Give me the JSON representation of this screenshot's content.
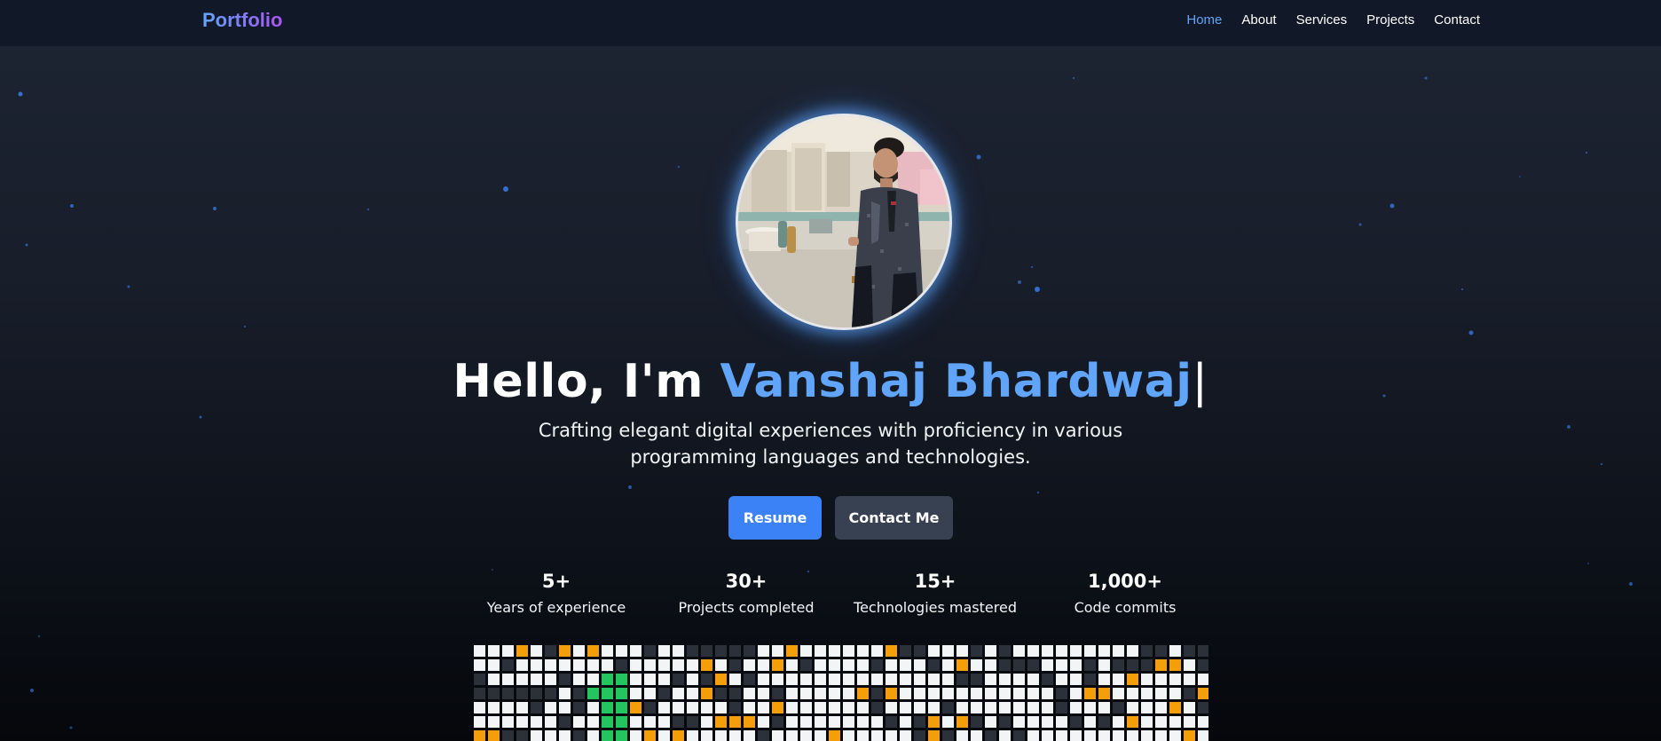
{
  "nav": {
    "logo": "Portfolio",
    "links": [
      {
        "label": "Home",
        "active": true
      },
      {
        "label": "About",
        "active": false
      },
      {
        "label": "Services",
        "active": false
      },
      {
        "label": "Projects",
        "active": false
      },
      {
        "label": "Contact",
        "active": false
      }
    ]
  },
  "hero": {
    "greeting": "Hello, I'm ",
    "name": "Vanshaj Bhardwaj",
    "cursor": "|",
    "subtitle": "Crafting elegant digital experiences with proficiency in various programming languages and technologies.",
    "buttons": {
      "resume": "Resume",
      "contact": "Contact Me"
    }
  },
  "stats": [
    {
      "value": "5+",
      "label": "Years of experience"
    },
    {
      "value": "30+",
      "label": "Projects completed"
    },
    {
      "value": "15+",
      "label": "Technologies mastered"
    },
    {
      "value": "1,000+",
      "label": "Code commits"
    }
  ],
  "colors": {
    "accent": "#60a5fa",
    "primary_button": "#3b82f6",
    "secondary_button": "#374151",
    "contrib_empty": "#f3f4f6",
    "contrib_dark": "#2b3039",
    "contrib_orange": "#f59e0b",
    "contrib_green": "#22c55e"
  },
  "icons": {
    "corner": "pet-icon",
    "avatar": "profile-photo"
  }
}
